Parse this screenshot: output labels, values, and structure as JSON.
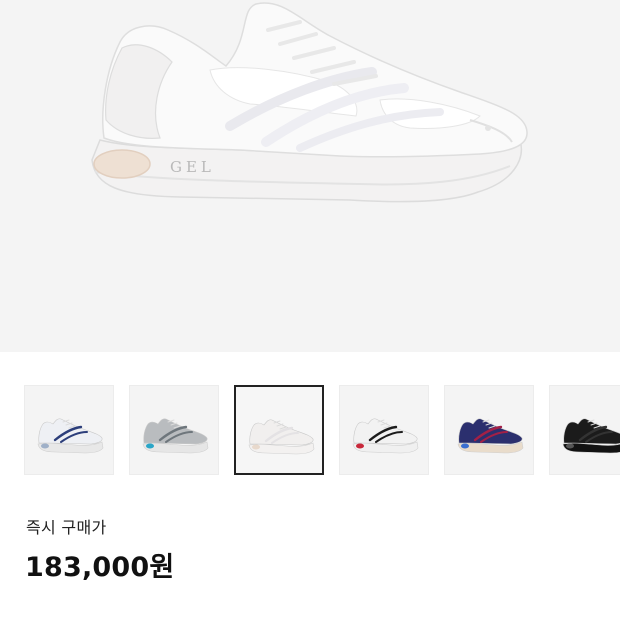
{
  "product": {
    "hero_image": "white-running-shoe-gel",
    "hero_logo_text": "GEL",
    "selected_index": 2,
    "thumbnails": [
      {
        "name": "white-navy-shoe",
        "colors": {
          "upper": "#eef0f4",
          "accent": "#2c3e7a",
          "sole": "#e8e8e8",
          "detail": "#9fb0c8"
        }
      },
      {
        "name": "grey-teal-shoe",
        "colors": {
          "upper": "#b9bcbf",
          "accent": "#6e767c",
          "sole": "#e6e6e6",
          "detail": "#2aa6c8"
        }
      },
      {
        "name": "all-white-shoe",
        "colors": {
          "upper": "#f1efee",
          "accent": "#e4e2e4",
          "sole": "#f3f1f0",
          "detail": "#e8d9cc"
        }
      },
      {
        "name": "white-black-red-shoe",
        "colors": {
          "upper": "#f2f2f2",
          "accent": "#1c1c1c",
          "sole": "#f0f0f0",
          "detail": "#c8283a"
        }
      },
      {
        "name": "navy-red-multicolor-shoe",
        "colors": {
          "upper": "#2b2f6e",
          "accent": "#a32046",
          "sole": "#e9dccb",
          "detail": "#3b6fd1"
        }
      },
      {
        "name": "black-shoe",
        "colors": {
          "upper": "#1b1b1b",
          "accent": "#333333",
          "sole": "#121212",
          "detail": "#555555"
        }
      }
    ]
  },
  "purchase": {
    "label": "즉시 구매가",
    "price": "183,000원"
  }
}
